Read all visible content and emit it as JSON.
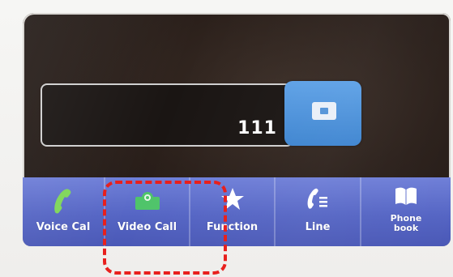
{
  "display": {
    "number": "111"
  },
  "backspace": {
    "icon": "backspace-icon"
  },
  "toolbar": {
    "buttons": [
      {
        "label": "Voice Cal",
        "icon": "phone-handset-icon",
        "icon_color": "#7fd65a"
      },
      {
        "label": "Video Call",
        "icon": "video-camera-icon",
        "icon_color": "#4fc46a"
      },
      {
        "label": "Function",
        "icon": "star-icon",
        "icon_color": "#ffffff"
      },
      {
        "label": "Line",
        "icon": "line-icon",
        "icon_color": "#ffffff"
      },
      {
        "label": "Phone book",
        "icon": "phonebook-icon",
        "icon_color": "#ffffff"
      }
    ]
  },
  "colors": {
    "toolbar": "#5565c4",
    "backspace": "#4a8fd9",
    "screen": "#2a1f1a",
    "highlight": "#e8201d"
  }
}
